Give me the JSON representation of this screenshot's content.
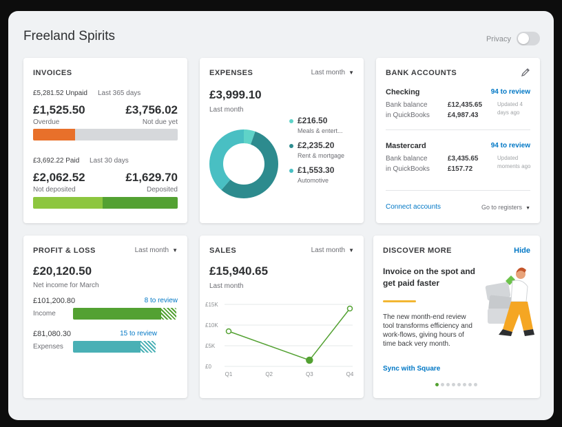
{
  "header": {
    "company": "Freeland Spirits",
    "privacy_label": "Privacy"
  },
  "invoices": {
    "title": "INVOICES",
    "unpaid_amount": "£5,281.52 Unpaid",
    "unpaid_period": "Last 365 days",
    "overdue_value": "£1,525.50",
    "overdue_label": "Overdue",
    "notdue_value": "£3,756.02",
    "notdue_label": "Not due yet",
    "paid_amount": "£3,692.22 Paid",
    "paid_period": "Last 30 days",
    "notdeposited_value": "£2,062.52",
    "notdeposited_label": "Not deposited",
    "deposited_value": "£1,629.70",
    "deposited_label": "Deposited",
    "overdue_fraction": 0.29,
    "notdeposited_fraction": 0.48,
    "colors": {
      "overdue": "#e8702a",
      "notdue": "#d6d8db",
      "notdeposited": "#8dc63f",
      "deposited": "#53a132"
    }
  },
  "expenses": {
    "title": "EXPENSES",
    "period": "Last month",
    "total": "£3,999.10",
    "total_label": "Last month",
    "items": [
      {
        "value": "£216.50",
        "label": "Meals & entert...",
        "amount": 216.5,
        "color": "#5fd3c8"
      },
      {
        "value": "£2,235.20",
        "label": "Rent & mortgage",
        "amount": 2235.2,
        "color": "#2d8b8e"
      },
      {
        "value": "£1,553.30",
        "label": "Automotive",
        "amount": 1553.3,
        "color": "#49bfc3"
      }
    ]
  },
  "bank": {
    "title": "BANK ACCOUNTS",
    "accounts": [
      {
        "name": "Checking",
        "review": "94 to review",
        "bank_label": "Bank balance",
        "bank_value": "£12,435.65",
        "qb_label": "in QuickBooks",
        "qb_value": "£4,987.43",
        "updated": "Updated 4",
        "updated2": "days ago"
      },
      {
        "name": "Mastercard",
        "review": "94 to review",
        "bank_label": "Bank balance",
        "bank_value": "£3,435.65",
        "qb_label": "in QuickBooks",
        "qb_value": "£157.72",
        "updated": "Updated",
        "updated2": "moments ago"
      }
    ],
    "connect": "Connect accounts",
    "registers": "Go to registers"
  },
  "profit_loss": {
    "title": "PROFIT & LOSS",
    "period": "Last month",
    "net": "£20,120.50",
    "net_label": "Net income for March",
    "income_value": "£101,200.80",
    "income_review": "8 to review",
    "income_label": "Income",
    "expenses_value": "£81,080.30",
    "expenses_review": "15 to review",
    "expenses_label": "Expenses",
    "income_fraction": 1.0,
    "expenses_fraction": 0.8,
    "colors": {
      "income": "#53a132",
      "expenses": "#49b0b5"
    }
  },
  "sales": {
    "title": "SALES",
    "period": "Last month",
    "total": "£15,940.65",
    "total_label": "Last month"
  },
  "chart_data": {
    "type": "line",
    "categories": [
      "Q1",
      "Q2",
      "Q3",
      "Q4"
    ],
    "values": [
      8500,
      null,
      1500,
      14000
    ],
    "x_positions": [
      1,
      2,
      3,
      4
    ],
    "ytick_labels": [
      "£15K",
      "£10K",
      "£5K",
      "£0"
    ],
    "yticks": [
      15000,
      10000,
      5000,
      0
    ],
    "ylim": [
      0,
      15000
    ],
    "line_color": "#53a132",
    "grid": true
  },
  "discover": {
    "title": "DISCOVER MORE",
    "hide": "Hide",
    "headline": "Invoice on the spot and get paid faster",
    "body": "The new month-end review tool transforms efficiency and work-flows, giving hours of time back very month.",
    "link": "Sync with Square",
    "pages": 8,
    "active_page": 0
  }
}
